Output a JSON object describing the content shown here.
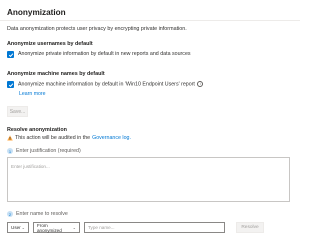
{
  "section": {
    "title": "Anonymization",
    "description": "Data anonymization protects user privacy by encrypting private information."
  },
  "usernames": {
    "heading": "Anonymize usernames by default",
    "checkbox_label": "Anonymize private information by default in new reports and data sources",
    "checked": true
  },
  "machines": {
    "heading": "Anonymize machine names by default",
    "checkbox_label": "Anonymize machine information by default in 'Win10 Endpoint Users' report",
    "checked": true,
    "learn_more": "Learn more"
  },
  "save_button": "Save...",
  "resolve": {
    "heading": "Resolve anonymization",
    "warning_text": "This action will be audited in the",
    "warning_link": "Governance log.",
    "step1_num": "1",
    "step1_label": "Enter justification (required)",
    "justification_placeholder": "Enter justification...",
    "step2_num": "2",
    "step2_label": "Enter name to resolve",
    "type_select": "User",
    "source_select": "From anonymized",
    "name_placeholder": "Type name...",
    "resolve_button": "Resolve"
  },
  "colors": {
    "accent": "#0078d4",
    "warning": "#ffaa44"
  }
}
